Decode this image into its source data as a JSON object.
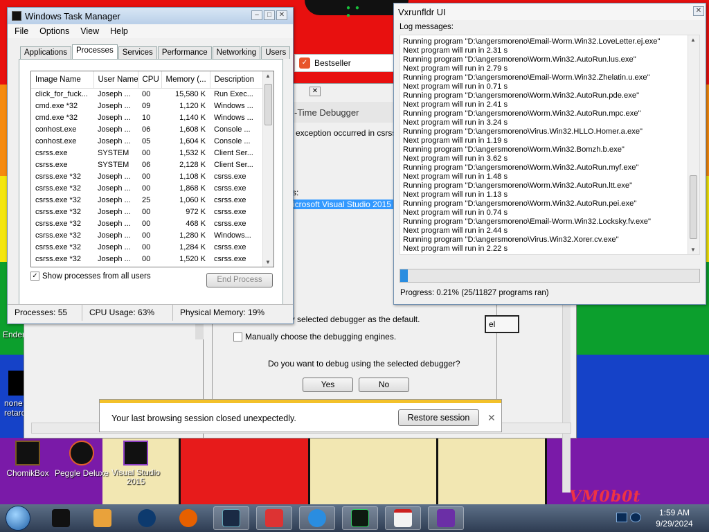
{
  "taskmgr": {
    "title": "Windows Task Manager",
    "menu": [
      "File",
      "Options",
      "View",
      "Help"
    ],
    "tabs": [
      "Applications",
      "Processes",
      "Services",
      "Performance",
      "Networking",
      "Users"
    ],
    "columns": [
      "Image Name",
      "User Name",
      "CPU",
      "Memory (...",
      "Description"
    ],
    "rows": [
      [
        "click_for_fuck...",
        "Joseph ...",
        "00",
        "15,580 K",
        "Run Exec..."
      ],
      [
        "cmd.exe *32",
        "Joseph ...",
        "09",
        "1,120 K",
        "Windows ..."
      ],
      [
        "cmd.exe *32",
        "Joseph ...",
        "10",
        "1,140 K",
        "Windows ..."
      ],
      [
        "conhost.exe",
        "Joseph ...",
        "06",
        "1,608 K",
        "Console ..."
      ],
      [
        "conhost.exe",
        "Joseph ...",
        "05",
        "1,604 K",
        "Console ..."
      ],
      [
        "csrss.exe",
        "SYSTEM",
        "00",
        "1,532 K",
        "Client Ser..."
      ],
      [
        "csrss.exe",
        "SYSTEM",
        "06",
        "2,128 K",
        "Client Ser..."
      ],
      [
        "csrss.exe *32",
        "Joseph ...",
        "00",
        "1,108 K",
        "csrss.exe"
      ],
      [
        "csrss.exe *32",
        "Joseph ...",
        "00",
        "1,868 K",
        "csrss.exe"
      ],
      [
        "csrss.exe *32",
        "Joseph ...",
        "25",
        "1,060 K",
        "csrss.exe"
      ],
      [
        "csrss.exe *32",
        "Joseph ...",
        "00",
        "972 K",
        "csrss.exe"
      ],
      [
        "csrss.exe *32",
        "Joseph ...",
        "00",
        "468 K",
        "csrss.exe"
      ],
      [
        "csrss.exe *32",
        "Joseph ...",
        "00",
        "1,280 K",
        "Windows..."
      ],
      [
        "csrss.exe *32",
        "Joseph ...",
        "00",
        "1,284 K",
        "csrss.exe"
      ],
      [
        "csrss.exe *32",
        "Joseph ...",
        "00",
        "1,520 K",
        "csrss.exe"
      ]
    ],
    "show_all_label": "Show processes from all users",
    "end_process_label": "End Process",
    "status": {
      "processes": "Processes: 55",
      "cpu": "CPU Usage: 63%",
      "memory": "Physical Memory: 19%"
    }
  },
  "vx": {
    "title": "Vxrunfldr UI",
    "log_label": "Log messages:",
    "log_lines": [
      "Running program \"D:\\angersmoreno\\Email-Worm.Win32.LoveLetter.ej.exe\"",
      "Next program will run in 2.31 s",
      "Running program \"D:\\angersmoreno\\Worm.Win32.AutoRun.lus.exe\"",
      "Next program will run in 2.79 s",
      "Running program \"D:\\angersmoreno\\Email-Worm.Win32.Zhelatin.u.exe\"",
      "Next program will run in 0.71 s",
      "Running program \"D:\\angersmoreno\\Worm.Win32.AutoRun.pde.exe\"",
      "Next program will run in 2.41 s",
      "Running program \"D:\\angersmoreno\\Worm.Win32.AutoRun.mpc.exe\"",
      "Next program will run in 3.24 s",
      "Running program \"D:\\angersmoreno\\Virus.Win32.HLLO.Homer.a.exe\"",
      "Next program will run in 1.19 s",
      "Running program \"D:\\angersmoreno\\Worm.Win32.Bomzh.b.exe\"",
      "Next program will run in 3.62 s",
      "Running program \"D:\\angersmoreno\\Worm.Win32.AutoRun.myf.exe\"",
      "Next program will run in 1.48 s",
      "Running program \"D:\\angersmoreno\\Worm.Win32.AutoRun.ltt.exe\"",
      "Next program will run in 1.13 s",
      "Running program \"D:\\angersmoreno\\Worm.Win32.AutoRun.pei.exe\"",
      "Next program will run in 0.74 s",
      "Running program \"D:\\angersmoreno\\Email-Worm.Win32.Locksky.fv.exe\"",
      "Next program will run in 2.44 s",
      "Running program \"D:\\angersmoreno\\Virus.Win32.Xorer.cv.exe\"",
      "Next program will run in 2.22 s"
    ],
    "progress_fraction": 0.0021,
    "progress_text": "Progress: 0.21% (25/11827 programs ran)"
  },
  "debugger": {
    "header": "-Time Debugger",
    "exception": "exception occurred in csrss.ex",
    "possible": "s:",
    "selected_item": "icrosoft Visual Studio 2015",
    "default_text": "ly selected debugger as the default.",
    "manual_label": "Manually choose the debugging engines.",
    "question": "Do you want to debug using the selected debugger?",
    "yes": "Yes",
    "no": "No",
    "partial_button": "el"
  },
  "bestseller": "Bestseller",
  "infobar": {
    "message": "Your last browsing session closed unexpectedly.",
    "restore": "Restore session"
  },
  "desktop": {
    "icons": [
      "ChomikBox",
      "Peggle Deluxe",
      "Visual Studio 2015"
    ],
    "partial_icon_left": "none retarc",
    "ender": "Ender",
    "logo": "VM0b0t"
  },
  "taskbar": {
    "time": "1:59 AM",
    "date": "9/29/2024"
  },
  "colors": {
    "progress": "#2a8de0",
    "selection": "#3399ff"
  }
}
